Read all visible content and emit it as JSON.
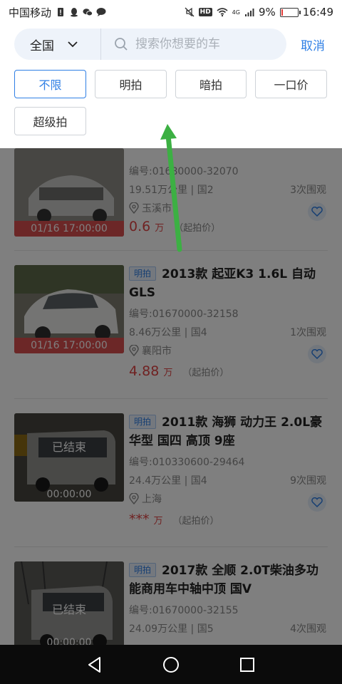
{
  "status_bar": {
    "carrier": "中国移动",
    "net": "4G",
    "battery": "9%",
    "time": "16:49",
    "battery_level": 0.09,
    "battery_color": "#e53935",
    "icons": [
      "sim-alert-icon",
      "qq-icon",
      "wechat-icon",
      "message-icon",
      "mute-icon",
      "hd-icon",
      "wifi-icon",
      "signal-icon",
      "battery-icon"
    ]
  },
  "search": {
    "region": "全国",
    "placeholder": "搜索你想要的车",
    "cancel": "取消"
  },
  "filters": {
    "options": [
      "不限",
      "明拍",
      "暗拍",
      "一口价",
      "超级拍"
    ],
    "selected": "不限"
  },
  "colors": {
    "accent": "#2f7fe5",
    "price": "#e04545",
    "time_bar": "#d94e4e",
    "annotation_arrow": "#3cb043"
  },
  "listings": [
    {
      "title": "",
      "code": "编号:01680000-32070",
      "specs": "19.51万公里 | 国2",
      "watchers": "3次围观",
      "city": "玉溪市",
      "price": "0.6",
      "unit": "万",
      "price_note": "（起拍价）",
      "time": "01/16 17:00:00"
    },
    {
      "tag": "明拍",
      "title": "2013款 起亚K3 1.6L 自动GLS",
      "code": "编号:01670000-32158",
      "specs": "8.46万公里 | 国4",
      "watchers": "1次围观",
      "city": "襄阳市",
      "price": "4.88",
      "unit": "万",
      "price_note": "（起拍价）",
      "time": "01/16 17:00:00"
    },
    {
      "tag": "明拍",
      "title": "2011款 海狮 动力王 2.0L豪华型 国四 高顶 9座",
      "code": "编号:010330600-29464",
      "specs": "24.4万公里 | 国4",
      "watchers": "9次围观",
      "city": "上海",
      "price": "***",
      "unit": "万",
      "price_note": "（起拍价）",
      "status": "已结束",
      "time": "00:00:00"
    },
    {
      "tag": "明拍",
      "title": "2017款 全顺 2.0T柴油多功能商用车中轴中顶 国V",
      "code": "编号:01670000-32155",
      "specs": "24.09万公里 | 国5",
      "watchers": "4次围观",
      "status": "已结束",
      "time": "00:00:00"
    }
  ],
  "nav": {
    "icons": [
      "back-icon",
      "home-icon",
      "recents-icon"
    ]
  }
}
